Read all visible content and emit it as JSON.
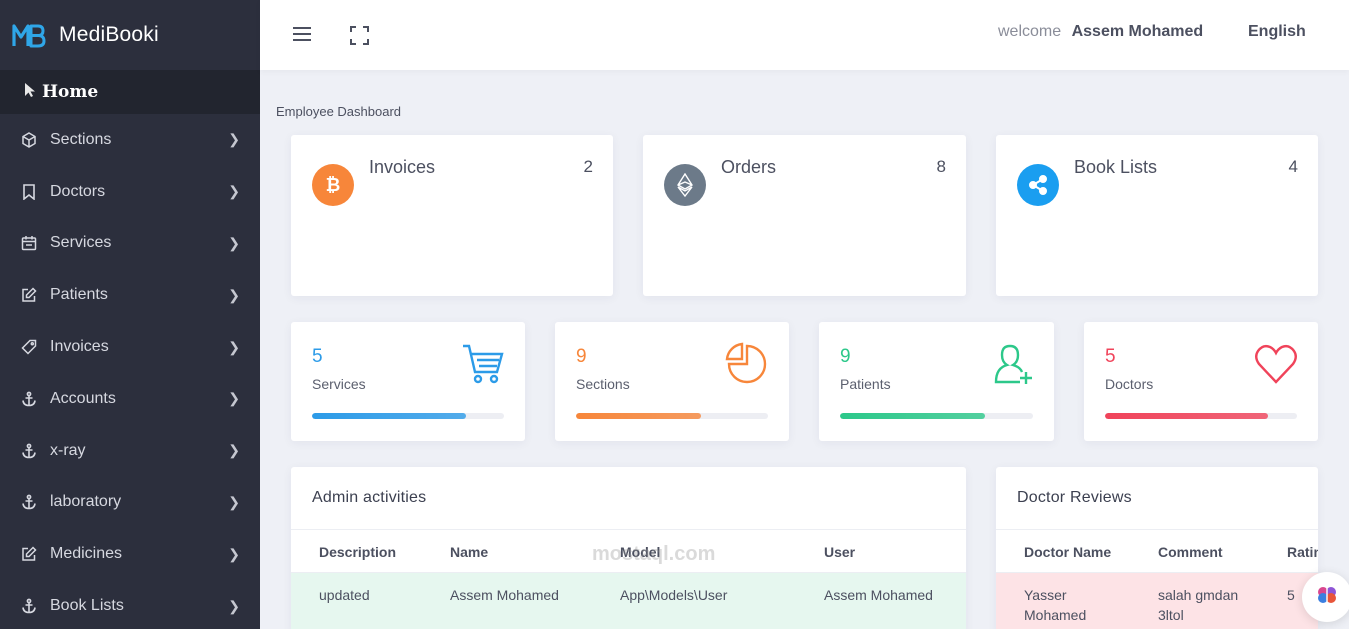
{
  "brand": {
    "name": "MediBooki",
    "logo_text": "MB"
  },
  "sidebar": {
    "home_label": "Home",
    "items": [
      {
        "label": "Sections",
        "icon": "cube-icon"
      },
      {
        "label": "Doctors",
        "icon": "bookmark-icon"
      },
      {
        "label": "Services",
        "icon": "calendar-icon"
      },
      {
        "label": "Patients",
        "icon": "edit-icon"
      },
      {
        "label": "Invoices",
        "icon": "tag-icon"
      },
      {
        "label": "Accounts",
        "icon": "anchor-icon"
      },
      {
        "label": "x-ray",
        "icon": "anchor-icon"
      },
      {
        "label": "laboratory",
        "icon": "anchor-icon"
      },
      {
        "label": "Medicines",
        "icon": "edit-icon"
      },
      {
        "label": "Book Lists",
        "icon": "anchor-icon"
      }
    ]
  },
  "header": {
    "welcome_prefix": "welcome",
    "user_name": "Assem Mohamed",
    "language": "English"
  },
  "breadcrumb": "Employee Dashboard",
  "top_cards": [
    {
      "title": "Invoices",
      "count": "2",
      "icon": "bitcoin-icon",
      "color": "#f7863a"
    },
    {
      "title": "Orders",
      "count": "8",
      "icon": "ethereum-icon",
      "color": "#6c7a89"
    },
    {
      "title": "Book Lists",
      "count": "4",
      "icon": "ripple-icon",
      "color": "#1a9ef0"
    }
  ],
  "stats": [
    {
      "value": "5",
      "label": "Services",
      "progress": 0.8,
      "color": "#2c9be8",
      "icon": "cart-icon"
    },
    {
      "value": "9",
      "label": "Sections",
      "progress": 0.65,
      "color": "#f7863a",
      "icon": "pie-chart-icon"
    },
    {
      "value": "9",
      "label": "Patients",
      "progress": 0.75,
      "color": "#2cc88a",
      "icon": "user-plus-icon"
    },
    {
      "value": "5",
      "label": "Doctors",
      "progress": 0.85,
      "color": "#f0435a",
      "icon": "heart-icon"
    }
  ],
  "admin_activities": {
    "title": "Admin activities",
    "columns": [
      "Description",
      "Name",
      "Model",
      "User"
    ],
    "rows": [
      [
        "updated",
        "Assem Mohamed",
        "App\\Models\\User",
        "Assem Mohamed"
      ]
    ]
  },
  "doctor_reviews": {
    "title": "Doctor Reviews",
    "columns": [
      "Doctor Name",
      "Comment",
      "Ratin"
    ],
    "rows": [
      [
        "Yasser Mohamed",
        "salah gmdan 3ltol",
        "5"
      ]
    ]
  },
  "watermark": "mostaql.com"
}
